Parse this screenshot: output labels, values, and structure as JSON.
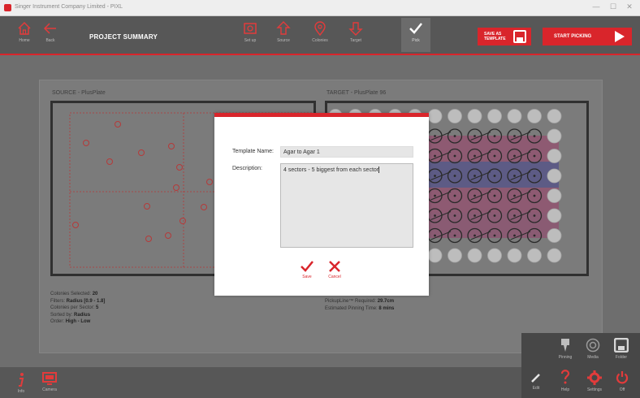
{
  "window": {
    "title": "Singer Instrument Company Limited - PIXL",
    "controls": [
      "—",
      "☐",
      "✕"
    ]
  },
  "toolbar": {
    "home_label": "Home",
    "back_label": "Back",
    "page_title": "PROJECT SUMMARY",
    "steps": [
      {
        "label": "Set up",
        "icon": "camera-plate-icon"
      },
      {
        "label": "Source",
        "icon": "arrow-up-icon"
      },
      {
        "label": "Colonies",
        "icon": "location-pin-icon"
      },
      {
        "label": "Target",
        "icon": "arrow-down-icon"
      },
      {
        "label": "Pick",
        "icon": "checkmark-icon"
      }
    ],
    "save_template_line1": "SAVE AS",
    "save_template_line2": "TEMPLATE",
    "start_picking_label": "START PICKING"
  },
  "summary": {
    "source_title": "SOURCE - PlusPlate",
    "target_title": "TARGET - PlusPlate 96",
    "source_info": [
      {
        "key": "Colonies Selected:",
        "value": "20"
      },
      {
        "key": "Filters:",
        "value": "Radius [0.9 - 1.8]"
      },
      {
        "key": "Colonies per Sector:",
        "value": "5"
      },
      {
        "key": "Sorted by:",
        "value": "Radius"
      },
      {
        "key": "Order:",
        "value": "High - Low"
      }
    ],
    "target_info": [
      {
        "key": "PickupLine™ Required:",
        "value": "29.7cm"
      },
      {
        "key": "Estimated Pinning Time:",
        "value": "8 mins"
      }
    ]
  },
  "modal": {
    "template_name_label": "Template Name:",
    "template_name_value": "Agar to Agar 1",
    "description_label": "Description:",
    "description_value": "4 sectors - 5 biggest from each sector",
    "save_label": "Save",
    "cancel_label": "Cancel"
  },
  "bottom": {
    "info_label": "Info",
    "camera_label": "Camera",
    "edit_label": "Edit",
    "help_label": "Help",
    "settings_label": "Settings",
    "off_label": "Off",
    "overlay_items": [
      {
        "label": "Pinning",
        "icon": "pin-icon"
      },
      {
        "label": "Media",
        "icon": "disc-icon"
      },
      {
        "label": "Folder",
        "icon": "save-disk-icon"
      }
    ]
  },
  "colors": {
    "accent": "#d9252b",
    "toolbar_bg": "#575757"
  }
}
